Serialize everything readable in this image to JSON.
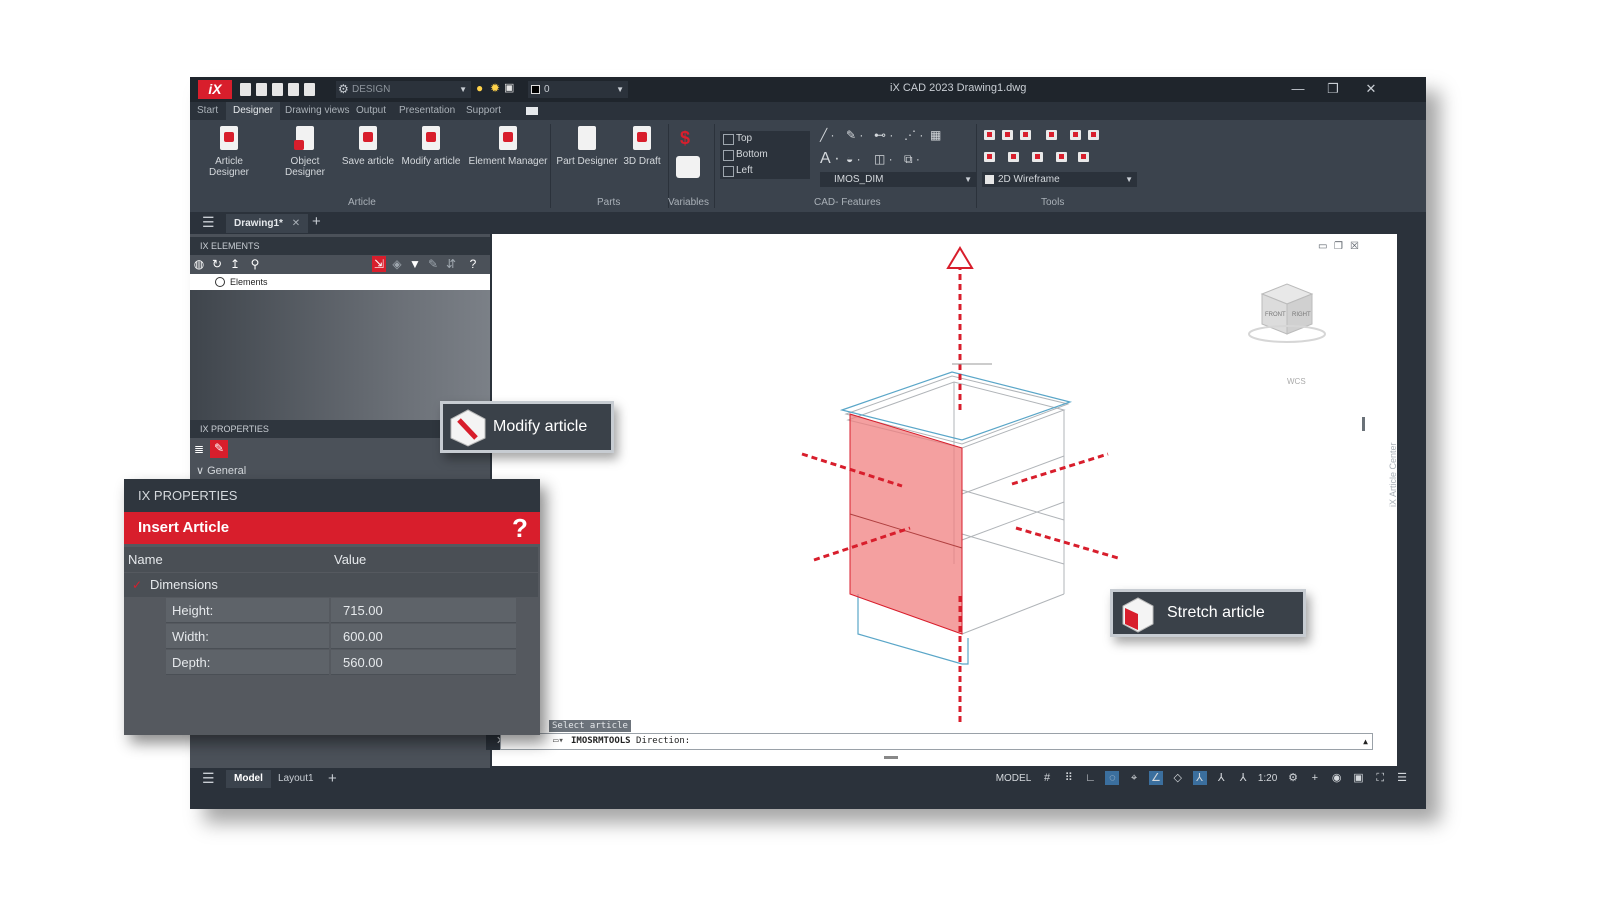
{
  "titlebar": {
    "logo": "iX",
    "workspace": "DESIGN",
    "layer": "0",
    "app_title": "iX CAD 2023   Drawing1.dwg",
    "minimize": "—",
    "restore": "❐",
    "close": "✕"
  },
  "menu_tabs": [
    "Start",
    "Designer",
    "Drawing views",
    "Output",
    "Presentation",
    "Support"
  ],
  "ribbon": {
    "buttons": {
      "article_designer": "Article Designer",
      "object_designer": "Object Designer",
      "save_article": "Save article",
      "modify_article": "Modify article",
      "element_manager": "Element Manager",
      "part_designer": "Part Designer",
      "draft_3d": "3D Draft"
    },
    "panels": {
      "article": "Article",
      "parts": "Parts",
      "variables": "Variables",
      "cad_features": "CAD- Features",
      "tools": "Tools"
    },
    "views": [
      "Top",
      "Bottom",
      "Left"
    ],
    "dim_style": "IMOS_DIM",
    "visual_style": "2D Wireframe"
  },
  "doc_tab": "Drawing1*",
  "elements_panel": {
    "header": "IX ELEMENTS",
    "tree_root": "Elements"
  },
  "properties_panel": {
    "header": "IX PROPERTIES",
    "section": "General"
  },
  "floating_props": {
    "header": "IX PROPERTIES",
    "title": "Insert Article",
    "help": "?",
    "col_name": "Name",
    "col_value": "Value",
    "section": "Dimensions",
    "rows": [
      {
        "name": "Height:",
        "value": "715.00"
      },
      {
        "name": "Width:",
        "value": "600.00"
      },
      {
        "name": "Depth:",
        "value": "560.00"
      }
    ]
  },
  "callouts": {
    "modify": "Modify article",
    "stretch": "Stretch article"
  },
  "viewcube": {
    "front": "FRONT",
    "right": "RIGHT",
    "wcs": "WCS"
  },
  "command": {
    "prompt_label": "Select article",
    "command_name": "IMOSRMTOOLS",
    "command_text": " Direction:"
  },
  "side_label": "iX Article Center",
  "statusbar": {
    "tabs": [
      "Model",
      "Layout1"
    ],
    "model": "MODEL",
    "scale": "1:20"
  },
  "colors": {
    "accent_red": "#d81e2c",
    "chrome_dark": "#2b323b",
    "ribbon": "#3b434d"
  }
}
